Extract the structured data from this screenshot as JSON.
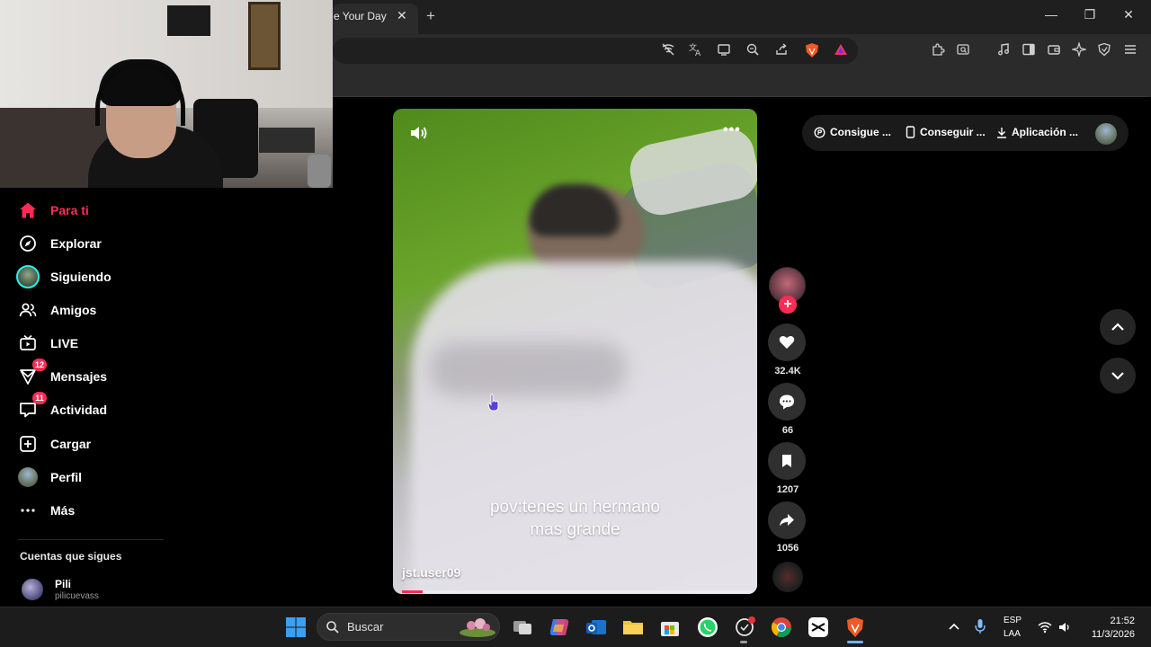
{
  "browser": {
    "tab_title": "e Your Day",
    "tab_close": "✕",
    "new_tab": "+",
    "window": {
      "minimize": "—",
      "restore": "❐",
      "close": "✕"
    }
  },
  "sidebar": {
    "items": [
      {
        "label": "Para ti",
        "icon": "home-icon",
        "active": true
      },
      {
        "label": "Explorar",
        "icon": "compass-icon"
      },
      {
        "label": "Siguiendo",
        "icon": "following-avatar-icon"
      },
      {
        "label": "Amigos",
        "icon": "friends-icon"
      },
      {
        "label": "LIVE",
        "icon": "live-tv-icon"
      },
      {
        "label": "Mensajes",
        "icon": "messages-icon",
        "badge": "12"
      },
      {
        "label": "Actividad",
        "icon": "activity-icon",
        "badge": "11"
      },
      {
        "label": "Cargar",
        "icon": "upload-icon"
      },
      {
        "label": "Perfil",
        "icon": "profile-avatar-icon"
      },
      {
        "label": "Más",
        "icon": "more-dots-icon"
      }
    ],
    "following_heading": "Cuentas que sigues",
    "following": [
      {
        "name": "Pili",
        "handle": "pilicuevass"
      }
    ]
  },
  "video": {
    "caption_line1": "pov:tenes un hermano",
    "caption_line2": "mas grande",
    "author": "jst.user09",
    "progress": 0.06,
    "more_label": "•••"
  },
  "actions": {
    "likes": "32.4K",
    "comments": "66",
    "saves": "1207",
    "shares": "1056",
    "follow_plus": "+"
  },
  "top_buttons": {
    "coins": "Consigue ...",
    "app": "Conseguir ...",
    "download": "Aplicación ..."
  },
  "taskbar": {
    "search_placeholder": "Buscar",
    "lang1": "ESP",
    "lang2": "LAA",
    "time": "21:52",
    "date": "11/3/2026"
  },
  "colors": {
    "accent": "#fe2c55",
    "cyan": "#25f4ee",
    "background": "#000000"
  }
}
